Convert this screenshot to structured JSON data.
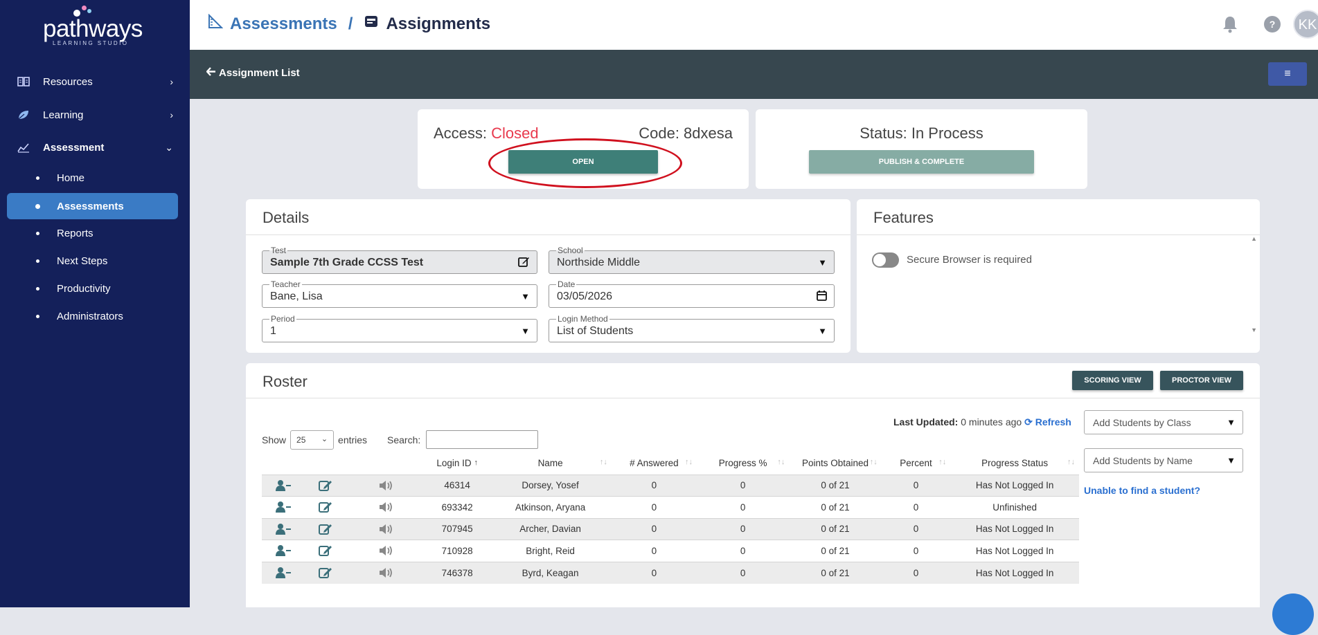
{
  "sidebar": {
    "logo_text": "pathways",
    "logo_sub": "LEARNING STUDIO",
    "nav": [
      {
        "label": "Resources",
        "icon": "book-icon",
        "chevron": "›"
      },
      {
        "label": "Learning",
        "icon": "leaf-icon",
        "chevron": "›"
      },
      {
        "label": "Assessment",
        "icon": "chart-icon",
        "chevron": "⌄"
      }
    ],
    "sub_items": [
      {
        "label": "Home",
        "active": false
      },
      {
        "label": "Assessments",
        "active": true
      },
      {
        "label": "Reports",
        "active": false
      },
      {
        "label": "Next Steps",
        "active": false
      },
      {
        "label": "Productivity",
        "active": false
      },
      {
        "label": "Administrators",
        "active": false
      }
    ]
  },
  "header": {
    "crumb1": "Assessments",
    "separator": "/",
    "crumb2": "Assignments",
    "help": "?",
    "avatar_initials": "KK"
  },
  "subbar": {
    "back_label": "Assignment List",
    "menu_icon": "≡"
  },
  "access": {
    "access_prefix": "Access:",
    "access_value": "Closed",
    "code_label": "Code: 8dxesa",
    "open_button": "OPEN"
  },
  "status": {
    "label": "Status: In Process",
    "publish_button": "PUBLISH & COMPLETE"
  },
  "details": {
    "title": "Details",
    "fields": {
      "test": {
        "label": "Test",
        "value": "Sample 7th Grade CCSS Test"
      },
      "school": {
        "label": "School",
        "value": "Northside Middle"
      },
      "teacher": {
        "label": "Teacher",
        "value": "Bane, Lisa"
      },
      "date": {
        "label": "Date",
        "value": "03/05/2026"
      },
      "period": {
        "label": "Period",
        "value": "1"
      },
      "login_method": {
        "label": "Login Method",
        "value": "List of Students"
      }
    }
  },
  "features": {
    "title": "Features",
    "secure_browser_label": "Secure Browser is required",
    "secure_browser_on": false
  },
  "roster": {
    "title": "Roster",
    "scoring_view": "SCORING VIEW",
    "proctor_view": "PROCTOR VIEW",
    "last_updated_label": "Last Updated:",
    "last_updated_value": "0 minutes ago",
    "refresh": "Refresh",
    "show_label": "Show",
    "entries_value": "25",
    "entries_label": "entries",
    "search_label": "Search:",
    "add_by_class": "Add Students by Class",
    "add_by_name": "Add Students by Name",
    "unable": "Unable to find a student?",
    "columns": [
      "Login ID",
      "Name",
      "# Answered",
      "Progress %",
      "Points Obtained",
      "Percent",
      "Progress Status"
    ],
    "rows": [
      {
        "login_id": "46314",
        "name": "Dorsey, Yosef",
        "answered": "0",
        "progress": "0",
        "points": "0 of 21",
        "percent": "0",
        "status": "Has Not Logged In"
      },
      {
        "login_id": "693342",
        "name": "Atkinson, Aryana",
        "answered": "0",
        "progress": "0",
        "points": "0 of 21",
        "percent": "0",
        "status": "Unfinished"
      },
      {
        "login_id": "707945",
        "name": "Archer, Davian",
        "answered": "0",
        "progress": "0",
        "points": "0 of 21",
        "percent": "0",
        "status": "Has Not Logged In"
      },
      {
        "login_id": "710928",
        "name": "Bright, Reid",
        "answered": "0",
        "progress": "0",
        "points": "0 of 21",
        "percent": "0",
        "status": "Has Not Logged In"
      },
      {
        "login_id": "746378",
        "name": "Byrd, Keagan",
        "answered": "0",
        "progress": "0",
        "points": "0 of 21",
        "percent": "0",
        "status": "Has Not Logged In"
      }
    ]
  },
  "colors": {
    "sidebar_bg": "#14205a",
    "active_item": "#3a7bc5",
    "closed_red": "#e8394d",
    "open_button": "#3e7f78",
    "subbar_bg": "#37474f",
    "link_blue": "#2a6fd0"
  }
}
